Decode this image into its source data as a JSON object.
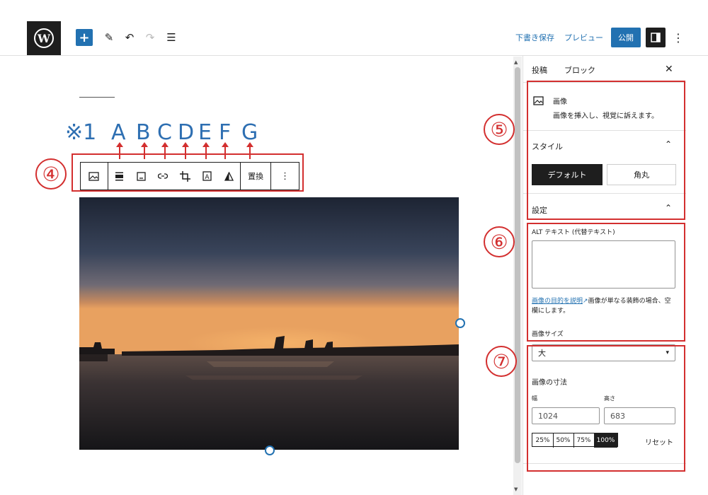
{
  "topbar": {
    "save_draft": "下書き保存",
    "preview": "プレビュー",
    "publish": "公開"
  },
  "annotation": {
    "note": "※1",
    "letters": [
      "A",
      "B",
      "C",
      "D",
      "E",
      "F",
      "G"
    ],
    "circles": [
      "④",
      "⑤",
      "⑥",
      "⑦"
    ],
    "color": "#d32f2f",
    "letter_color": "#2e6fb2"
  },
  "block_toolbar": {
    "replace": "置換"
  },
  "sidebar": {
    "tabs": [
      "投稿",
      "ブロック"
    ],
    "block_name": "画像",
    "block_desc": "画像を挿入し、視覚に訴えます。",
    "styles_title": "スタイル",
    "style_default": "デフォルト",
    "style_rounded": "角丸",
    "settings_title": "設定",
    "alt_label": "ALT テキスト (代替テキスト)",
    "alt_link": "画像の目的を説明",
    "alt_help": "画像が単なる装飾の場合、空欄にします。",
    "size_label": "画像サイズ",
    "size_value": "大",
    "dims_title": "画像の寸法",
    "width_label": "幅",
    "height_label": "高さ",
    "width_value": "1024",
    "height_value": "683",
    "percents": [
      "25%",
      "50%",
      "75%",
      "100%"
    ],
    "reset": "リセット"
  },
  "colors": {
    "accent": "#2271b1",
    "dark": "#1e1e1e"
  }
}
